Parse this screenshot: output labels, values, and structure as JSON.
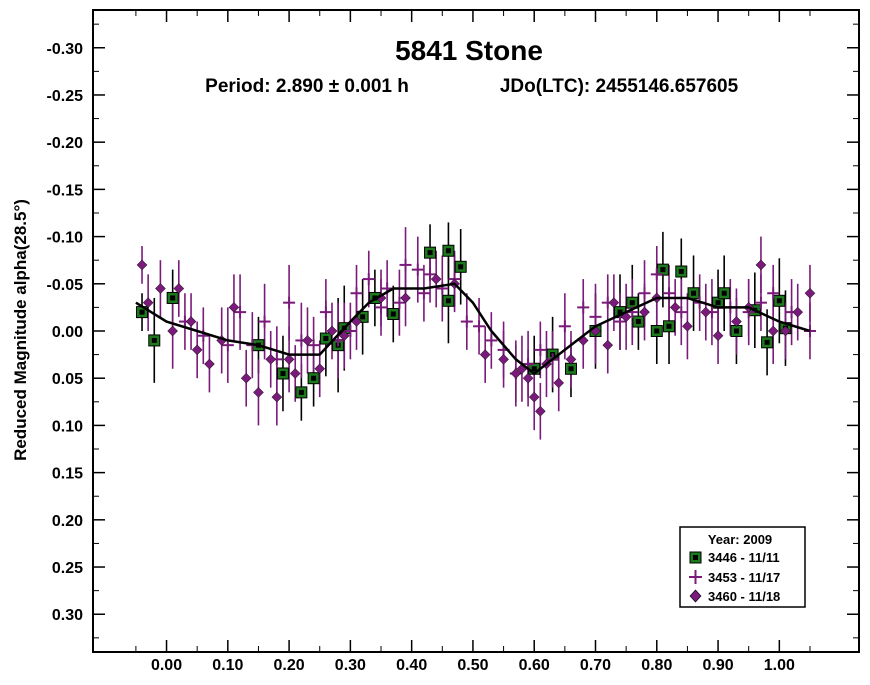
{
  "colors": {
    "frame": "#000000",
    "green_fill": "#1c7a1c",
    "purple": "#7a1a7a",
    "fit_line": "#000000"
  },
  "chart_data": {
    "type": "scatter",
    "title": "5841 Stone",
    "subtitle_period": "Period: 2.890 ± 0.001 h",
    "subtitle_epoch": "JDo(LTC): 2455146.657605",
    "ylabel": "Reduced Magnitude alpha(28.5°)",
    "xlabel": "",
    "xlim": [
      -0.12,
      1.13
    ],
    "ylim": [
      -0.34,
      0.34
    ],
    "y_inverted": true,
    "grid": false,
    "legend_position": "bottom-right",
    "x_ticks": [
      "0.00",
      "0.10",
      "0.20",
      "0.30",
      "0.40",
      "0.50",
      "0.60",
      "0.70",
      "0.80",
      "0.90",
      "1.00"
    ],
    "x_tick_values": [
      0,
      0.1,
      0.2,
      0.3,
      0.4,
      0.5,
      0.6,
      0.7,
      0.8,
      0.9,
      1.0
    ],
    "y_ticks": [
      "-0.30",
      "-0.25",
      "-0.20",
      "-0.15",
      "-0.10",
      "-0.05",
      "0.00",
      "0.05",
      "0.10",
      "0.15",
      "0.20",
      "0.25",
      "0.30"
    ],
    "y_tick_values": [
      -0.3,
      -0.25,
      -0.2,
      -0.15,
      -0.1,
      -0.05,
      0.0,
      0.05,
      0.1,
      0.15,
      0.2,
      0.25,
      0.3
    ],
    "legend": {
      "title": "Year: 2009",
      "entries": [
        "3446 - 11/11",
        "3453 - 11/17",
        "3460 - 11/18"
      ]
    },
    "fit_curve": {
      "x": [
        -0.05,
        0.0,
        0.05,
        0.1,
        0.15,
        0.2,
        0.25,
        0.3,
        0.33,
        0.37,
        0.42,
        0.47,
        0.5,
        0.53,
        0.57,
        0.6,
        0.63,
        0.67,
        0.7,
        0.75,
        0.8,
        0.85,
        0.9,
        0.95,
        1.0,
        1.05
      ],
      "y": [
        -0.03,
        -0.01,
        0.0,
        0.01,
        0.015,
        0.025,
        0.025,
        -0.01,
        -0.03,
        -0.045,
        -0.045,
        -0.05,
        -0.03,
        0.0,
        0.03,
        0.045,
        0.03,
        0.01,
        -0.005,
        -0.02,
        -0.035,
        -0.035,
        -0.025,
        -0.025,
        -0.01,
        0.0
      ]
    },
    "series": [
      {
        "name": "3446 - 11/11",
        "marker": "square",
        "x": [
          -0.04,
          -0.02,
          0.01,
          0.15,
          0.19,
          0.22,
          0.24,
          0.26,
          0.28,
          0.29,
          0.32,
          0.34,
          0.37,
          0.43,
          0.46,
          0.46,
          0.48,
          0.6,
          0.63,
          0.66,
          0.7,
          0.74,
          0.76,
          0.77,
          0.8,
          0.81,
          0.82,
          0.84,
          0.86,
          0.9,
          0.91,
          0.93,
          0.96,
          0.98,
          1.0,
          1.01
        ],
        "y": [
          -0.02,
          0.01,
          -0.035,
          0.015,
          0.045,
          0.065,
          0.05,
          0.008,
          0.015,
          -0.003,
          -0.015,
          -0.035,
          -0.018,
          -0.083,
          -0.085,
          -0.032,
          -0.068,
          0.04,
          0.025,
          0.04,
          0.0,
          -0.02,
          -0.03,
          -0.01,
          0.0,
          -0.065,
          -0.005,
          -0.063,
          -0.04,
          -0.03,
          -0.04,
          0.0,
          -0.022,
          0.012,
          -0.032,
          -0.003
        ],
        "err": [
          0.02,
          0.045,
          0.03,
          0.03,
          0.04,
          0.03,
          0.03,
          0.04,
          0.05,
          0.045,
          0.04,
          0.03,
          0.03,
          0.03,
          0.03,
          0.045,
          0.04,
          0.035,
          0.04,
          0.03,
          0.04,
          0.04,
          0.04,
          0.03,
          0.035,
          0.04,
          0.04,
          0.035,
          0.04,
          0.035,
          0.04,
          0.035,
          0.04,
          0.035,
          0.045,
          0.04
        ]
      },
      {
        "name": "3453 - 11/17",
        "marker": "plus",
        "x": [
          0.03,
          0.06,
          0.1,
          0.12,
          0.14,
          0.16,
          0.18,
          0.2,
          0.22,
          0.24,
          0.26,
          0.28,
          0.3,
          0.31,
          0.33,
          0.35,
          0.36,
          0.38,
          0.39,
          0.41,
          0.42,
          0.43,
          0.45,
          0.47,
          0.49,
          0.51,
          0.53,
          0.55,
          0.57,
          0.59,
          0.61,
          0.63,
          0.65,
          0.68,
          0.7,
          0.72,
          0.74,
          0.76,
          0.78,
          0.8,
          0.82,
          0.84,
          0.87,
          0.89,
          0.92,
          0.95,
          0.97,
          0.99,
          1.02,
          1.05
        ],
        "y": [
          -0.01,
          0.005,
          0.015,
          -0.02,
          0.015,
          -0.01,
          0.03,
          -0.03,
          0.01,
          0.015,
          -0.02,
          0.01,
          0.0,
          -0.04,
          -0.055,
          -0.025,
          -0.045,
          -0.03,
          -0.07,
          -0.065,
          -0.04,
          -0.06,
          -0.045,
          -0.055,
          -0.01,
          -0.005,
          0.01,
          0.02,
          0.045,
          0.035,
          0.02,
          0.03,
          -0.005,
          -0.025,
          -0.015,
          -0.03,
          -0.01,
          -0.02,
          -0.04,
          -0.06,
          -0.04,
          -0.02,
          -0.03,
          -0.02,
          -0.025,
          -0.02,
          -0.03,
          -0.04,
          -0.02,
          0.0
        ],
        "err": [
          0.03,
          0.03,
          0.04,
          0.04,
          0.035,
          0.04,
          0.035,
          0.04,
          0.04,
          0.03,
          0.035,
          0.04,
          0.03,
          0.03,
          0.03,
          0.03,
          0.03,
          0.035,
          0.04,
          0.035,
          0.03,
          0.03,
          0.035,
          0.03,
          0.03,
          0.03,
          0.03,
          0.03,
          0.035,
          0.035,
          0.03,
          0.03,
          0.035,
          0.03,
          0.035,
          0.03,
          0.03,
          0.035,
          0.035,
          0.03,
          0.03,
          0.035,
          0.03,
          0.035,
          0.03,
          0.035,
          0.03,
          0.03,
          0.035,
          0.03
        ]
      },
      {
        "name": "3460 - 11/18",
        "marker": "diamond",
        "x": [
          -0.04,
          -0.03,
          -0.01,
          0.01,
          0.02,
          0.04,
          0.05,
          0.07,
          0.09,
          0.11,
          0.13,
          0.15,
          0.17,
          0.18,
          0.2,
          0.21,
          0.23,
          0.25,
          0.27,
          0.29,
          0.31,
          0.35,
          0.39,
          0.44,
          0.47,
          0.52,
          0.55,
          0.57,
          0.58,
          0.59,
          0.6,
          0.61,
          0.62,
          0.64,
          0.66,
          0.68,
          0.7,
          0.72,
          0.73,
          0.75,
          0.78,
          0.8,
          0.83,
          0.85,
          0.88,
          0.9,
          0.93,
          0.95,
          0.97,
          0.99,
          1.01,
          1.03,
          1.05
        ],
        "y": [
          -0.07,
          -0.03,
          -0.045,
          0.0,
          -0.045,
          -0.01,
          0.02,
          0.035,
          0.01,
          -0.025,
          0.05,
          0.065,
          0.03,
          0.07,
          0.03,
          0.045,
          0.01,
          0.04,
          0.0,
          0.005,
          -0.01,
          -0.035,
          -0.035,
          -0.055,
          -0.05,
          0.025,
          0.03,
          0.045,
          0.04,
          0.05,
          0.07,
          0.085,
          0.035,
          0.055,
          0.03,
          0.01,
          0.0,
          0.015,
          -0.03,
          -0.015,
          -0.02,
          -0.035,
          -0.025,
          -0.005,
          -0.02,
          0.005,
          -0.01,
          -0.025,
          -0.07,
          0.0,
          0.0,
          -0.02,
          -0.04
        ],
        "err": [
          0.02,
          0.03,
          0.03,
          0.04,
          0.03,
          0.03,
          0.03,
          0.03,
          0.035,
          0.035,
          0.03,
          0.035,
          0.03,
          0.03,
          0.035,
          0.03,
          0.035,
          0.03,
          0.03,
          0.035,
          0.03,
          0.03,
          0.03,
          0.03,
          0.03,
          0.03,
          0.03,
          0.03,
          0.035,
          0.03,
          0.035,
          0.03,
          0.035,
          0.03,
          0.03,
          0.03,
          0.035,
          0.03,
          0.03,
          0.035,
          0.03,
          0.03,
          0.03,
          0.035,
          0.03,
          0.03,
          0.035,
          0.03,
          0.03,
          0.035,
          0.03,
          0.03,
          0.03
        ]
      }
    ]
  }
}
